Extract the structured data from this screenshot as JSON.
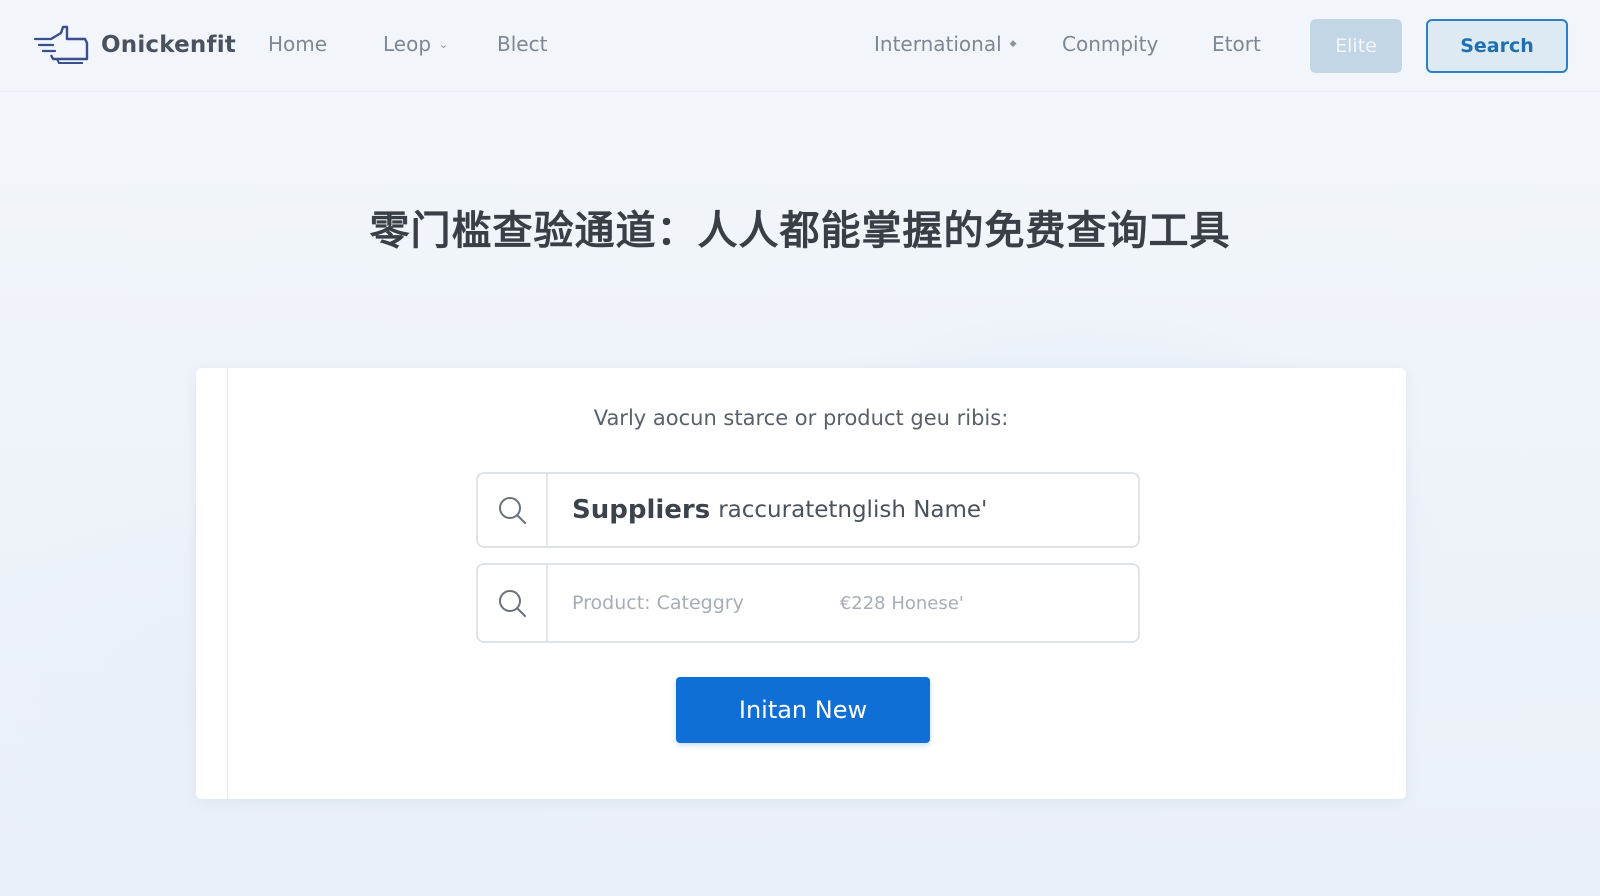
{
  "header": {
    "brand": {
      "name": "Onickenfit",
      "logo_icon": "hand-pointer-logo-icon"
    },
    "nav": [
      {
        "label": "Home"
      },
      {
        "label": "Leop",
        "icon": "chevron-down-icon"
      },
      {
        "label": "Blect"
      },
      {
        "label": "International",
        "icon": "diamond-icon"
      },
      {
        "label": "Conmpity"
      },
      {
        "label": "Etort"
      }
    ],
    "buttons": {
      "elite_label": "Elite",
      "search_label": "Search"
    }
  },
  "main": {
    "title": "零门槛查验通道：人人都能掌握的免费查询工具",
    "card": {
      "prompt": "Varly aocun starce or product geu ribis:",
      "field1": {
        "icon": "search-icon",
        "value_strong": "Suppliers",
        "value_rest": "raccuratetnglish Name'"
      },
      "field2": {
        "icon": "search-icon",
        "placeholder": "Product: Categgry",
        "placeholder_extra": "€228 Honese'"
      },
      "cta_label": "Initan New"
    }
  },
  "colors": {
    "accent": "#0f6fd6",
    "search_border": "#2d7fc1",
    "elite_bg": "#c3d6e6",
    "header_bg": "#f2f5f9"
  }
}
